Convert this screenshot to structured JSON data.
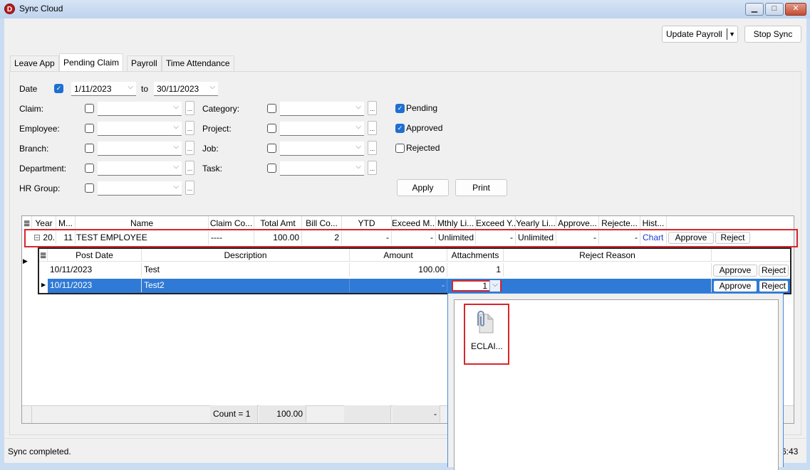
{
  "window": {
    "title": "Sync Cloud",
    "app_icon_letter": "D",
    "minimize_glyph": "▭",
    "maximize_glyph": "□",
    "close_glyph": "✕"
  },
  "toolbar": {
    "update_payroll_label": "Update Payroll",
    "update_payroll_dropdown_glyph": "▼",
    "stop_sync_label": "Stop Sync"
  },
  "tabs": [
    {
      "label": "Leave App",
      "active": false
    },
    {
      "label": "Pending Claim",
      "active": true
    },
    {
      "label": "Payroll",
      "active": false
    },
    {
      "label": "Time Attendance",
      "active": false
    }
  ],
  "filters": {
    "date_label": "Date",
    "date_checked": true,
    "date_from": "1/11/2023",
    "to_label": "to",
    "date_to": "30/11/2023",
    "left": [
      {
        "label": "Claim:",
        "checked": false,
        "value": ""
      },
      {
        "label": "Employee:",
        "checked": false,
        "value": ""
      },
      {
        "label": "Branch:",
        "checked": false,
        "value": ""
      },
      {
        "label": "Department:",
        "checked": false,
        "value": ""
      },
      {
        "label": "HR Group:",
        "checked": false,
        "value": ""
      }
    ],
    "right": [
      {
        "label": "Category:",
        "checked": false,
        "value": ""
      },
      {
        "label": "Project:",
        "checked": false,
        "value": ""
      },
      {
        "label": "Job:",
        "checked": false,
        "value": ""
      },
      {
        "label": "Task:",
        "checked": false,
        "value": ""
      }
    ],
    "status": [
      {
        "label": "Pending",
        "checked": true
      },
      {
        "label": "Approved",
        "checked": true
      },
      {
        "label": "Rejected",
        "checked": false
      }
    ],
    "ellipsis": "...",
    "chevron": "⌵",
    "check_glyph": "✓",
    "apply_label": "Apply",
    "print_label": "Print"
  },
  "grid": {
    "columns": [
      "Year",
      "M...",
      "Name",
      "Claim Co...",
      "Total Amt",
      "Bill Co...",
      "YTD",
      "Exceed M...",
      "Mthly Li...",
      "Exceed Y...",
      "Yearly Li...",
      "Approve...",
      "Rejecte...",
      "Hist..."
    ],
    "row": {
      "expand_glyph": "⊟",
      "year": "20...",
      "month": "11",
      "name": "TEST EMPLOYEE",
      "claim_code": "----",
      "total_amt": "100.00",
      "bill_count": "2",
      "ytd": "-",
      "exceed_monthly": "-",
      "monthly_limit": "Unlimited",
      "exceed_yearly": "-",
      "yearly_limit": "Unlimited",
      "approved": "-",
      "rejected": "-",
      "history_link": "Chart",
      "approve_label": "Approve",
      "reject_label": "Reject"
    },
    "detail": {
      "columns": [
        "Post Date",
        "Description",
        "Amount",
        "Attachments",
        "Reject Reason"
      ],
      "rows": [
        {
          "post_date": "10/11/2023",
          "description": "Test",
          "amount": "100.00",
          "attachments": "1",
          "reject_reason": "",
          "approve_label": "Approve",
          "reject_label": "Reject",
          "selected": false
        },
        {
          "post_date": "10/11/2023",
          "description": "Test2",
          "amount": "-",
          "attachments": "1",
          "reject_reason": "",
          "approve_label": "Approve",
          "reject_label": "Reject",
          "selected": true
        }
      ]
    },
    "footer": {
      "count": "Count = 1",
      "total": "100.00",
      "exceed": "-"
    }
  },
  "attachment_popup": {
    "items": [
      {
        "name": "ECLAI...",
        "icon": "paperclip-file-icon"
      }
    ]
  },
  "status_bar": {
    "message": "Sync completed.",
    "time": "6:43"
  }
}
